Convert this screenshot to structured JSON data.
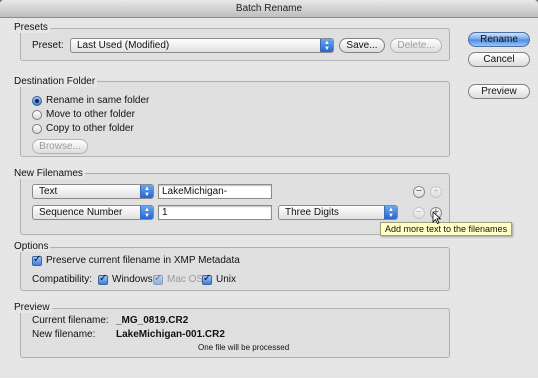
{
  "window": {
    "title": "Batch Rename"
  },
  "buttons": {
    "rename": "Rename",
    "cancel": "Cancel",
    "preview": "Preview"
  },
  "presets": {
    "group_title": "Presets",
    "preset_label": "Preset:",
    "preset_value": "Last Used (Modified)",
    "save_label": "Save...",
    "delete_label": "Delete..."
  },
  "destination": {
    "group_title": "Destination Folder",
    "options": [
      {
        "label": "Rename in same folder",
        "selected": true
      },
      {
        "label": "Move to other folder",
        "selected": false
      },
      {
        "label": "Copy to other folder",
        "selected": false
      }
    ],
    "browse_label": "Browse..."
  },
  "new_filenames": {
    "group_title": "New Filenames",
    "rows": [
      {
        "type": "Text",
        "value": "LakeMichigan-"
      },
      {
        "type": "Sequence Number",
        "value": "1",
        "format": "Three Digits"
      }
    ],
    "tooltip": "Add more text to the filenames"
  },
  "options": {
    "group_title": "Options",
    "preserve_label": "Preserve current filename in XMP Metadata",
    "preserve_checked": true,
    "compatibility_label": "Compatibility:",
    "platforms": [
      {
        "label": "Windows",
        "checked": true,
        "enabled": true
      },
      {
        "label": "Mac OS",
        "checked": true,
        "enabled": false
      },
      {
        "label": "Unix",
        "checked": true,
        "enabled": true
      }
    ]
  },
  "preview": {
    "group_title": "Preview",
    "current_label": "Current filename:",
    "current_value": "_MG_0819.CR2",
    "new_label": "New filename:",
    "new_value": "LakeMichigan-001.CR2",
    "note": "One file will be processed"
  }
}
